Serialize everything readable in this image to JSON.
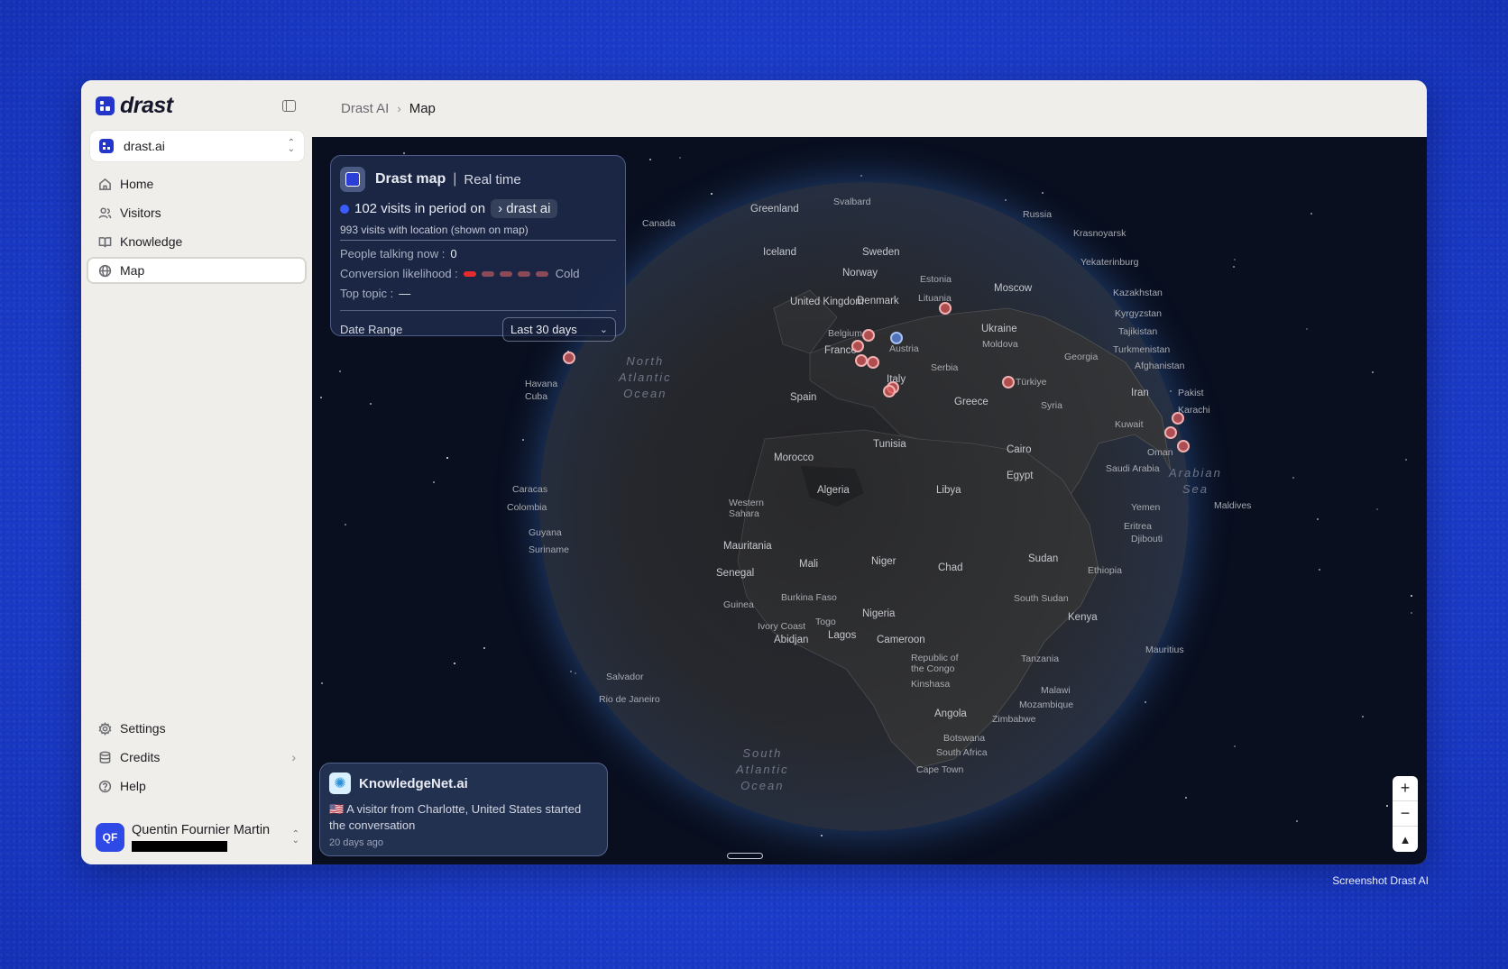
{
  "app": {
    "logo_text": "drast",
    "workspace": "drast.ai"
  },
  "sidebar": {
    "items": [
      {
        "label": "Home",
        "icon": "home-icon"
      },
      {
        "label": "Visitors",
        "icon": "users-icon"
      },
      {
        "label": "Knowledge",
        "icon": "book-icon"
      },
      {
        "label": "Map",
        "icon": "globe-icon",
        "active": true
      }
    ],
    "bottom_items": [
      {
        "label": "Settings",
        "icon": "gear-icon"
      },
      {
        "label": "Credits",
        "icon": "database-icon"
      },
      {
        "label": "Help",
        "icon": "help-icon"
      }
    ],
    "user": {
      "initials": "QF",
      "name": "Quentin Fournier Martin"
    }
  },
  "breadcrumb": [
    "Drast AI",
    "Map"
  ],
  "map_panel": {
    "title": "Drast map",
    "mode": "Real time",
    "visits_text": "102 visits in period on",
    "site_pill": "drast ai",
    "location_text": "993 visits with location (shown on map)",
    "people_talking_label": "People talking now :",
    "people_talking_value": "0",
    "conversion_label": "Conversion likelihood :",
    "conversion_level": 1,
    "conversion_total": 5,
    "conversion_text": "Cold",
    "top_topic_label": "Top topic :",
    "top_topic_value": "—",
    "date_range_label": "Date Range",
    "date_range_value": "Last 30 days"
  },
  "notification": {
    "title": "KnowledgeNet.ai",
    "flag": "🇺🇸",
    "text": "A visitor from Charlotte, United States started the conversation",
    "time": "20 days ago"
  },
  "map_labels": {
    "canada": "Canada",
    "greenland": "Greenland",
    "svalbard": "Svalbard",
    "russia": "Russia",
    "krasnoyarsk": "Krasnoyarsk",
    "iceland": "Iceland",
    "sweden": "Sweden",
    "yekaterinburg": "Yekaterinburg",
    "norway": "Norway",
    "estonia": "Estonia",
    "moscow": "Moscow",
    "denmark": "Denmark",
    "lithuania": "Lituania",
    "kazakhstan": "Kazakhstan",
    "uk": "United Kingdom",
    "belgium": "Belgium",
    "ukraine": "Ukraine",
    "kyrgyzstan": "Kyrgyzstan",
    "tajikistan": "Tajikistan",
    "moldova": "Moldova",
    "austria": "Austria",
    "france": "France",
    "georgia": "Georgia",
    "turkmenistan": "Turkmenistan",
    "serbia": "Serbia",
    "afghanistan": "Afghanistan",
    "north_atlantic": "North\nAtlantic\nOcean",
    "italy": "Italy",
    "turkiye": "Türkiye",
    "pakistan": "Pakist",
    "spain": "Spain",
    "greece": "Greece",
    "syria": "Syria",
    "iran": "Iran",
    "karachi": "Karachi",
    "havana": "Havana",
    "cuba": "Cuba",
    "kuwait": "Kuwait",
    "tunisia": "Tunisia",
    "cairo": "Cairo",
    "oman": "Oman",
    "morocco": "Morocco",
    "egypt": "Egypt",
    "saudi": "Saudi Arabia",
    "arabian_sea": "Arabian\nSea",
    "caracas": "Caracas",
    "colombia": "Colombia",
    "algeria": "Algeria",
    "libya": "Libya",
    "yemen": "Yemen",
    "maldives": "Maldives",
    "western_sahara": "Western\nSahara",
    "guyana": "Guyana",
    "eritrea": "Eritrea",
    "djibouti": "Djibouti",
    "suriname": "Suriname",
    "mauritania": "Mauritania",
    "sudan": "Sudan",
    "mali": "Mali",
    "niger": "Niger",
    "chad": "Chad",
    "senegal": "Senegal",
    "ethiopia": "Ethiopia",
    "burkina": "Burkina Faso",
    "south_sudan": "South Sudan",
    "guinea": "Guinea",
    "togo": "Togo",
    "nigeria": "Nigeria",
    "kenya": "Kenya",
    "ivory": "Ivory Coast",
    "abidjan": "Abidjan",
    "lagos": "Lagos",
    "cameroon": "Cameroon",
    "congo": "Republic of\nthe Congo",
    "mauritius": "Mauritius",
    "tanzania": "Tanzania",
    "kinshasa": "Kinshasa",
    "salvador": "Salvador",
    "malawi": "Malawi",
    "rio": "Rio de Janeiro",
    "mozambique": "Mozambique",
    "angola": "Angola",
    "zimbabwe": "Zimbabwe",
    "botswana": "Botswana",
    "south_africa": "South Africa",
    "south_atlantic": "South\nAtlantic\nOcean",
    "cape_town": "Cape Town"
  },
  "footer_note": "Screenshot Drast AI",
  "colors": {
    "accent": "#2436c9",
    "page_bg": "#1d3fd0",
    "map_bg": "#090f1f",
    "dot_red": "#e05a5a",
    "dot_blue": "#5a82dc"
  }
}
